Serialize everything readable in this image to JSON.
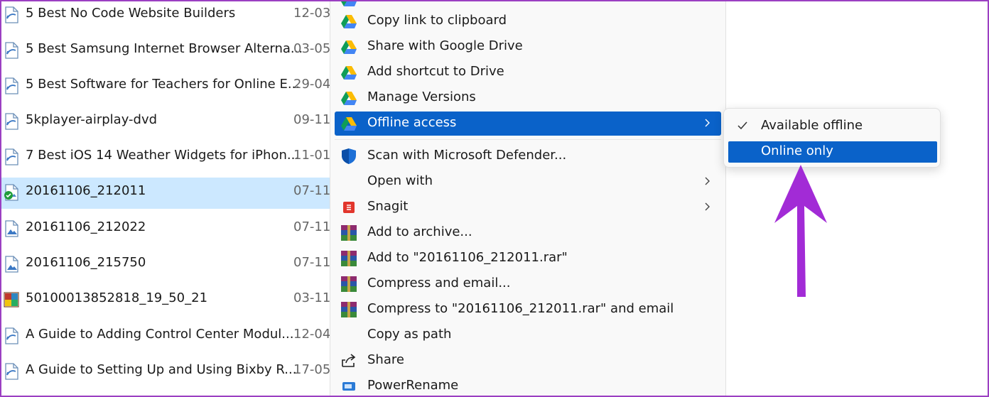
{
  "files": [
    {
      "name": "5 Best No Code Website Builders",
      "date": "12-03-",
      "icon": "web-shortcut-icon",
      "selected": false
    },
    {
      "name": "5 Best Samsung Internet Browser Alterna...",
      "date": "03-05-",
      "icon": "web-shortcut-icon",
      "selected": false
    },
    {
      "name": "5 Best Software for Teachers for Online E...",
      "date": "29-04-",
      "icon": "web-shortcut-icon",
      "selected": false
    },
    {
      "name": "5kplayer-airplay-dvd",
      "date": "09-11-",
      "icon": "web-shortcut-icon",
      "selected": false
    },
    {
      "name": "7 Best iOS 14 Weather Widgets for iPhon...",
      "date": "11-01-",
      "icon": "web-shortcut-icon",
      "selected": false
    },
    {
      "name": "20161106_212011",
      "date": "07-11-",
      "icon": "image-synced-icon",
      "selected": true
    },
    {
      "name": "20161106_212022",
      "date": "07-11-",
      "icon": "image-file-icon",
      "selected": false
    },
    {
      "name": "20161106_215750",
      "date": "07-11-",
      "icon": "image-file-icon",
      "selected": false
    },
    {
      "name": "50100013852818_19_50_21",
      "date": "03-11-",
      "icon": "photo-file-icon",
      "selected": false
    },
    {
      "name": "A Guide to Adding Control Center Modul...",
      "date": "12-04-",
      "icon": "web-shortcut-icon",
      "selected": false
    },
    {
      "name": "A Guide to Setting Up and Using Bixby R...",
      "date": "17-05-",
      "icon": "web-shortcut-icon",
      "selected": false
    }
  ],
  "menu": {
    "items": [
      {
        "label": "Copy link to clipboard",
        "icon": "google-drive-icon"
      },
      {
        "label": "Share with Google Drive",
        "icon": "google-drive-icon"
      },
      {
        "label": "Add shortcut to Drive",
        "icon": "google-drive-icon"
      },
      {
        "label": "Manage Versions",
        "icon": "google-drive-icon"
      },
      {
        "label": "Offline access",
        "icon": "google-drive-icon"
      },
      {
        "label": "Scan with Microsoft Defender...",
        "icon": "defender-shield-icon"
      },
      {
        "label": "Open with",
        "icon": ""
      },
      {
        "label": "Snagit",
        "icon": "snagit-icon"
      },
      {
        "label": "Add to archive...",
        "icon": "winrar-icon"
      },
      {
        "label": "Add to \"20161106_212011.rar\"",
        "icon": "winrar-icon"
      },
      {
        "label": "Compress and email...",
        "icon": "winrar-icon"
      },
      {
        "label": "Compress to \"20161106_212011.rar\" and email",
        "icon": "winrar-icon"
      },
      {
        "label": "Copy as path",
        "icon": ""
      },
      {
        "label": "Share",
        "icon": "share-icon"
      },
      {
        "label": "PowerRename",
        "icon": "powerrename-icon"
      }
    ]
  },
  "submenu": {
    "items": [
      {
        "label": "Available offline",
        "checked": true
      },
      {
        "label": "Online only",
        "checked": false
      }
    ]
  },
  "colors": {
    "accent": "#0a62c9",
    "selection": "#cce8ff",
    "annotation_arrow": "#a22bd6"
  }
}
